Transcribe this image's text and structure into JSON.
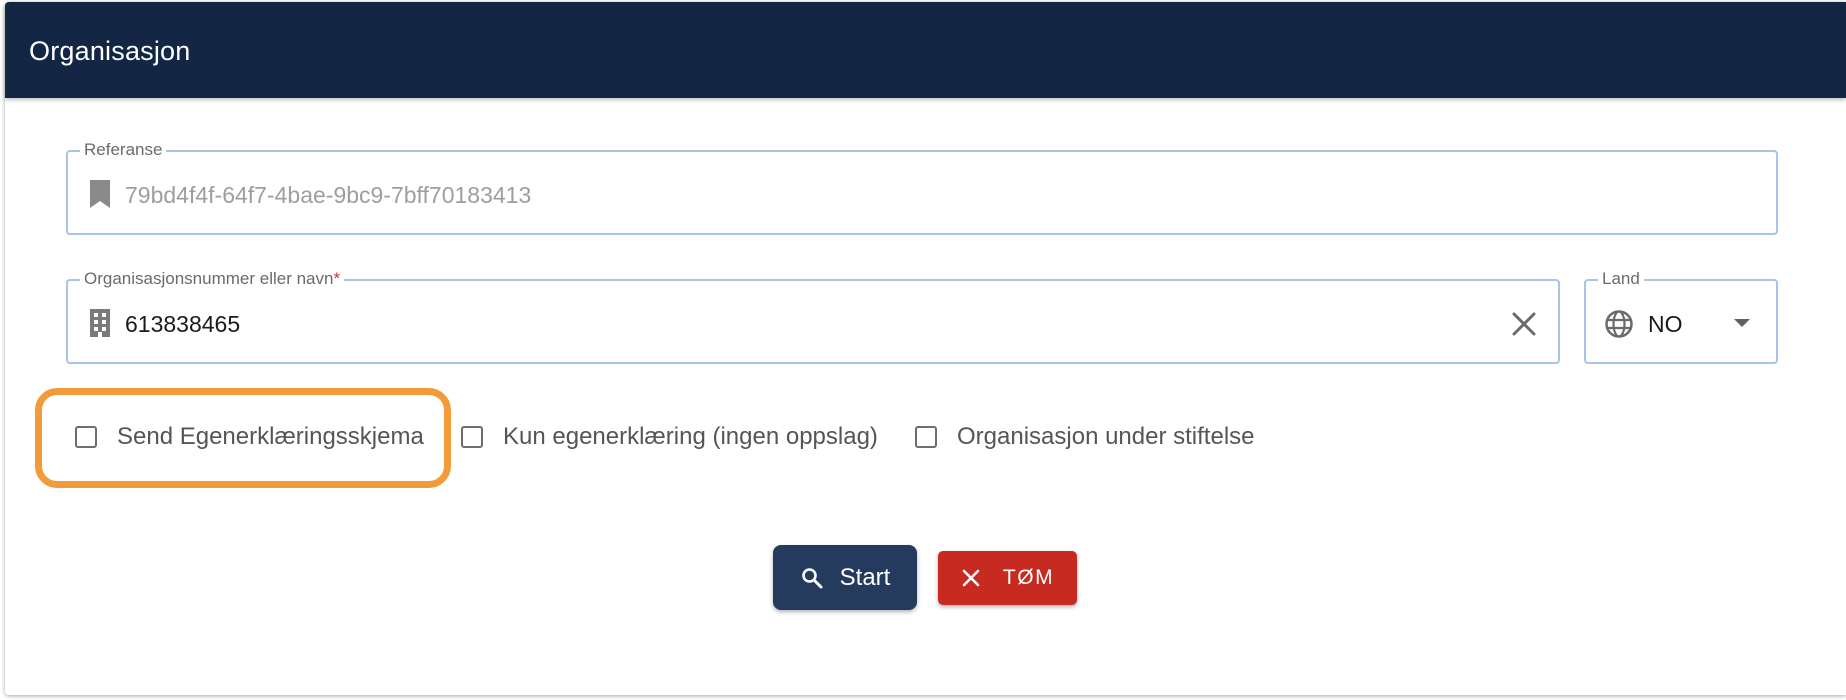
{
  "header": {
    "title": "Organisasjon"
  },
  "referanse": {
    "label": "Referanse",
    "value": "79bd4f4f-64f7-4bae-9bc9-7bff70183413",
    "icon": "bookmark-icon"
  },
  "organisasjon": {
    "label": "Organisasjonsnummer eller navn",
    "required_mark": "*",
    "value": "613838465",
    "icon": "building-icon",
    "clear_icon": "close-icon"
  },
  "land": {
    "label": "Land",
    "value": "NO",
    "icon": "globe-icon"
  },
  "checkboxes": [
    {
      "label": "Send Egenerklæringsskjema",
      "checked": false
    },
    {
      "label": "Kun egenerklæring (ingen oppslag)",
      "checked": false
    },
    {
      "label": "Organisasjon under stiftelse",
      "checked": false
    }
  ],
  "buttons": {
    "start_label": "Start",
    "clear_label": "TØM"
  },
  "colors": {
    "header_bg": "#132644",
    "field_border": "#a9c4e6",
    "highlight": "#f39a3b",
    "start_bg": "#253b5e",
    "clear_bg": "#c62a20"
  }
}
